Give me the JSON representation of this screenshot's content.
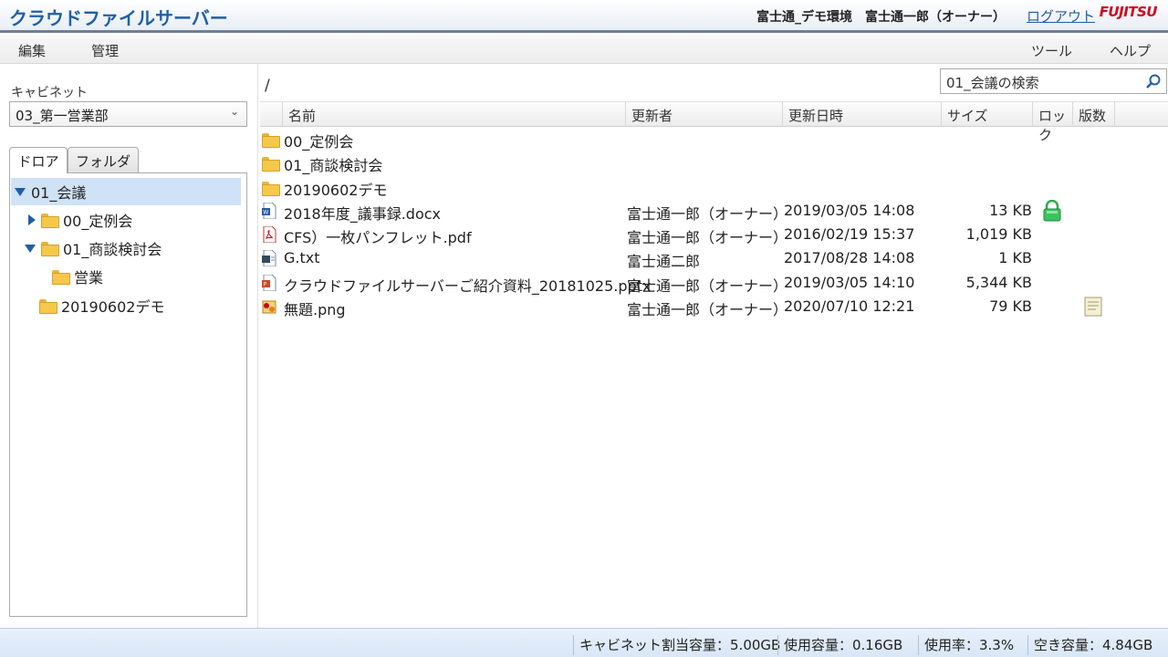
{
  "header": {
    "app_title": "クラウドファイルサーバー",
    "user_info": "富士通_デモ環境　富士通一郎（オーナー）",
    "logout": "ログアウト",
    "logo": "FUJITSU"
  },
  "menu": {
    "edit": "編集",
    "manage": "管理",
    "tools": "ツール",
    "help": "ヘルプ"
  },
  "left": {
    "cabinet_label": "キャビネット",
    "cabinet_value": "03_第一営業部",
    "tabs": [
      "ドロア",
      "フォルダ"
    ],
    "tree": [
      {
        "label": "01_会議"
      },
      {
        "label": "00_定例会"
      },
      {
        "label": "01_商談検討会"
      },
      {
        "label": "営業"
      },
      {
        "label": "20190602デモ"
      }
    ]
  },
  "main": {
    "breadcrumb": "/",
    "search_value": "01_会議の検索",
    "columns": [
      "名前",
      "更新者",
      "更新日時",
      "サイズ",
      "ロック",
      "版数"
    ],
    "rows": [
      {
        "name": "00_定例会",
        "user": "",
        "date": "",
        "size": ""
      },
      {
        "name": "01_商談検討会",
        "user": "",
        "date": "",
        "size": ""
      },
      {
        "name": "20190602デモ",
        "user": "",
        "date": "",
        "size": ""
      },
      {
        "name": "2018年度_議事録.docx",
        "user": "富士通一郎（オーナー）",
        "date": "2019/03/05 14:08",
        "size": "13 KB"
      },
      {
        "name": "CFS）一枚パンフレット.pdf",
        "user": "富士通一郎（オーナー）",
        "date": "2016/02/19 15:37",
        "size": "1,019 KB"
      },
      {
        "name": "G.txt",
        "user": "富士通二郎",
        "date": "2017/08/28 14:08",
        "size": "1 KB"
      },
      {
        "name": "クラウドファイルサーバーご紹介資料_20181025.pptx",
        "user": "富士通一郎（オーナー）",
        "date": "2019/03/05 14:10",
        "size": "5,344 KB"
      },
      {
        "name": "無題.png",
        "user": "富士通一郎（オーナー）",
        "date": "2020/07/10 12:21",
        "size": "79 KB"
      }
    ]
  },
  "status": {
    "cabinet_quota": "キャビネット割当容量：5.00GB",
    "used": "使用容量：0.16GB",
    "usage_rate": "使用率：3.3%",
    "free": "空き容量：4.84GB"
  },
  "colors": {
    "accent": "#1f5fa8",
    "logo": "#d0021b",
    "selection": "#cfe2f6"
  }
}
